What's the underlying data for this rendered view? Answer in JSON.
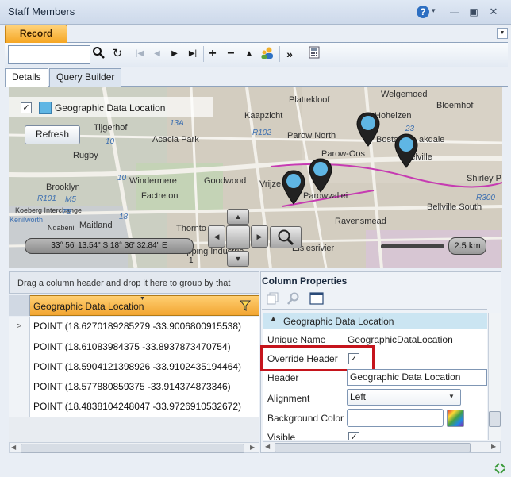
{
  "window": {
    "title": "Staff Members"
  },
  "tabs": {
    "record": "Record"
  },
  "subtabs": [
    "Details",
    "Query Builder"
  ],
  "toolbar": {
    "search_value": "",
    "icons": [
      "search-icon",
      "refresh-icon",
      "first-icon",
      "prev-icon",
      "next-icon",
      "last-icon",
      "add-icon",
      "remove-icon",
      "up-icon",
      "users-icon",
      "fast-forward-icon",
      "calculator-icon"
    ]
  },
  "map": {
    "legend_label": "Geographic Data Location",
    "refresh_label": "Refresh",
    "coordinates": "33° 56' 13.54\" S 18° 36' 32.84\" E",
    "scale": "2.5 km",
    "places": [
      "Plattekloof",
      "Welgemoed",
      "Bloemhof",
      "Kaapzicht",
      "Hoheizen",
      "Tijgerhof",
      "Acacia Park",
      "Parow North",
      "Bosta",
      "akdale",
      "Rugby",
      "Parow-Oos",
      "Belville",
      "Shirley P",
      "Windermere",
      "Goodwood",
      "Vrijze",
      "Parowvallei",
      "Brooklyn",
      "Factreton",
      "Bellville South",
      "Maitland",
      "Thornto",
      "Ravensmead",
      "Elsiesrivier",
      "Ndabeni",
      "Epping Industria",
      "Koeberg Interchange",
      "Kenilworth"
    ],
    "roads": [
      "13A",
      "R102",
      "23",
      "10",
      "10",
      "M5",
      "7B",
      "R101",
      "18",
      "R300",
      "1"
    ]
  },
  "grid": {
    "group_hint": "Drag a column header and drop it here to group by that column",
    "column": "Geographic Data Location",
    "rows": [
      "POINT (18.6270189285279 -33.9006800915538)",
      "POINT (18.61083984375 -33.8937873470754)",
      "POINT (18.5904121398926 -33.9102435194464)",
      "POINT (18.577880859375 -33.914374873346)",
      "POINT (18.4838104248047 -33.9726910532672)"
    ]
  },
  "properties": {
    "title": "Column Properties",
    "section": "Geographic Data Location",
    "unique_name_label": "Unique Name",
    "unique_name_value": "GeographicDataLocation",
    "override_header_label": "Override Header",
    "override_header_checked": true,
    "header_label": "Header",
    "header_value": "Geographic Data Location",
    "alignment_label": "Alignment",
    "alignment_value": "Left",
    "background_label": "Background Color",
    "background_value": "",
    "visible_label": "Visible"
  }
}
